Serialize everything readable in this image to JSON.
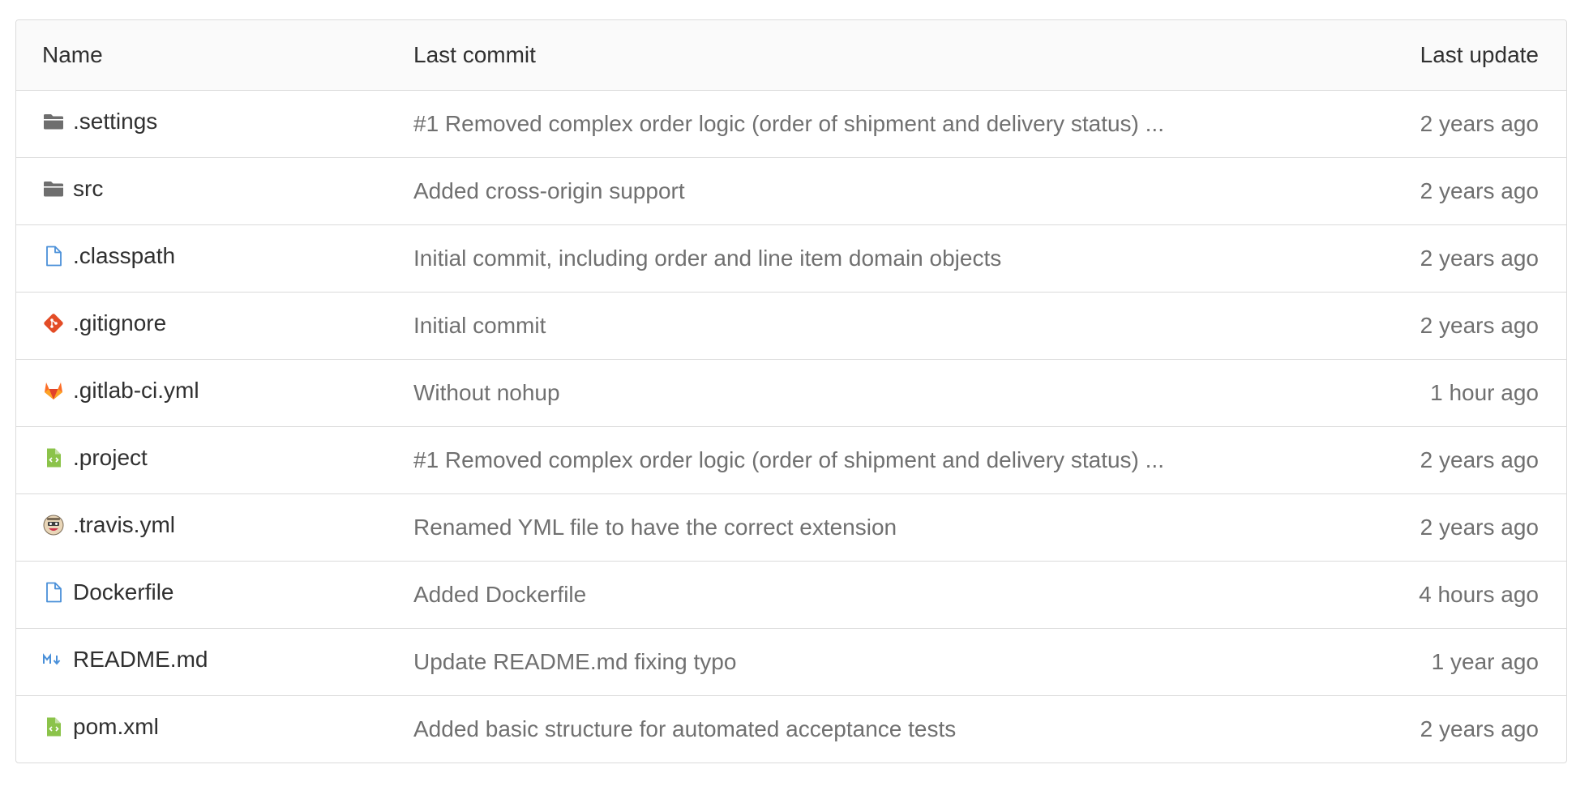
{
  "columns": {
    "name": "Name",
    "last_commit": "Last commit",
    "last_update": "Last update"
  },
  "files": [
    {
      "name": ".settings",
      "icon": "folder-icon",
      "commit": "#1 Removed complex order logic (order of shipment and delivery status) ...",
      "updated": "2 years ago"
    },
    {
      "name": "src",
      "icon": "folder-icon",
      "commit": "Added cross-origin support",
      "updated": "2 years ago"
    },
    {
      "name": ".classpath",
      "icon": "file-icon",
      "commit": "Initial commit, including order and line item domain objects",
      "updated": "2 years ago"
    },
    {
      "name": ".gitignore",
      "icon": "git-icon",
      "commit": "Initial commit",
      "updated": "2 years ago"
    },
    {
      "name": ".gitlab-ci.yml",
      "icon": "gitlab-icon",
      "commit": "Without nohup",
      "updated": "1 hour ago"
    },
    {
      "name": ".project",
      "icon": "xml-file-icon",
      "commit": "#1 Removed complex order logic (order of shipment and delivery status) ...",
      "updated": "2 years ago"
    },
    {
      "name": ".travis.yml",
      "icon": "travis-icon",
      "commit": "Renamed YML file to have the correct extension",
      "updated": "2 years ago"
    },
    {
      "name": "Dockerfile",
      "icon": "file-icon",
      "commit": "Added Dockerfile",
      "updated": "4 hours ago"
    },
    {
      "name": "README.md",
      "icon": "markdown-icon",
      "commit": "Update README.md fixing typo",
      "updated": "1 year ago"
    },
    {
      "name": "pom.xml",
      "icon": "xml-file-icon",
      "commit": "Added basic structure for automated acceptance tests",
      "updated": "2 years ago"
    }
  ],
  "colors": {
    "folder": "#6e6e6e",
    "file": "#4a90d9",
    "git": "#e34c26",
    "gitlab": "#fc6d26",
    "xml": "#8bc34a",
    "markdown": "#4a90d9",
    "border": "#dbdbdb",
    "header_bg": "#fafafa",
    "muted_text": "#707070"
  }
}
